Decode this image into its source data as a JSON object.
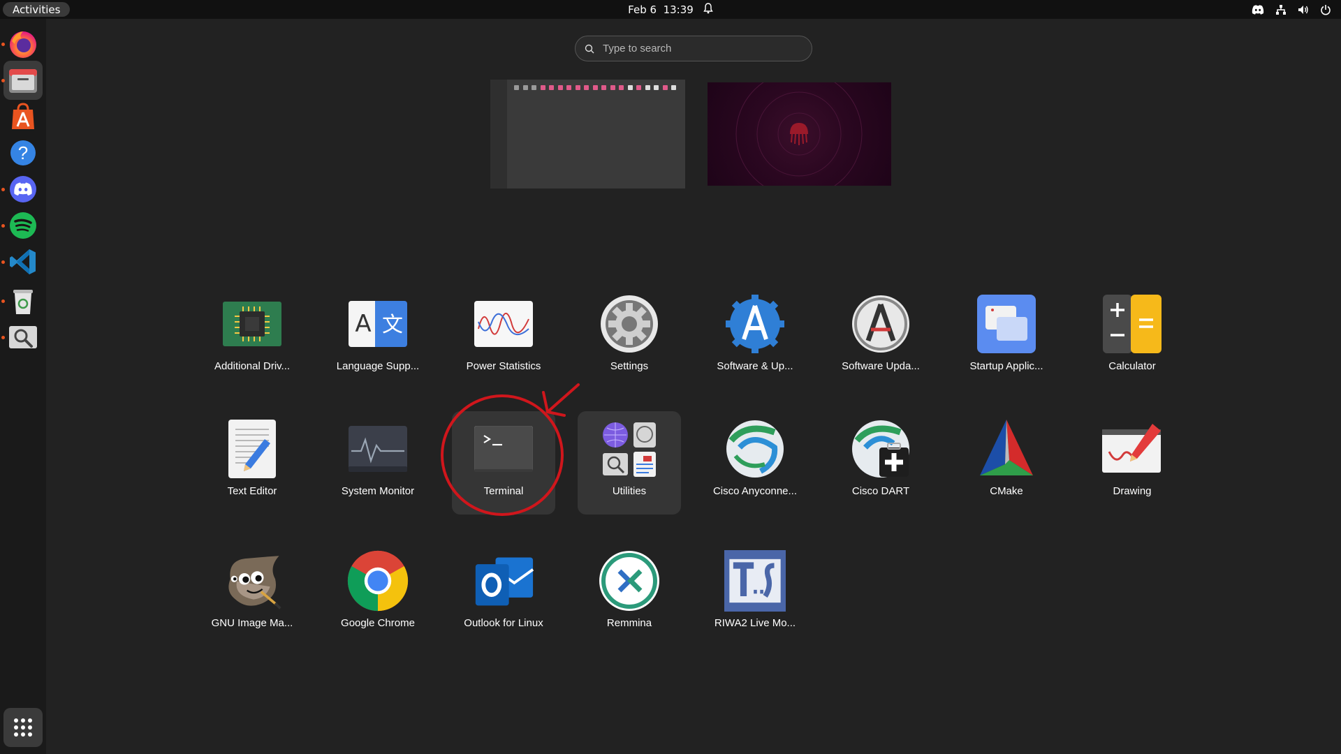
{
  "topbar": {
    "activities_label": "Activities",
    "date": "Feb 6",
    "time": "13:39"
  },
  "search": {
    "placeholder": "Type to search",
    "value": ""
  },
  "dock": {
    "items": [
      {
        "name": "Firefox",
        "icon": "firefox-icon",
        "running": true
      },
      {
        "name": "Files",
        "icon": "files-icon",
        "running": true
      },
      {
        "name": "Ubuntu Software",
        "icon": "software-icon",
        "running": false
      },
      {
        "name": "Help",
        "icon": "help-icon",
        "running": false
      },
      {
        "name": "Discord",
        "icon": "discord-icon",
        "running": true
      },
      {
        "name": "Spotify",
        "icon": "spotify-icon",
        "running": true
      },
      {
        "name": "Visual Studio Code",
        "icon": "vscode-icon",
        "running": true
      },
      {
        "name": "Trash",
        "icon": "trash-icon",
        "running": true
      },
      {
        "name": "Image Viewer",
        "icon": "image-viewer-icon",
        "running": true
      }
    ]
  },
  "apps": {
    "row1": [
      {
        "label": "Additional Driv...",
        "icon": "chip-icon"
      },
      {
        "label": "Language Supp...",
        "icon": "language-icon"
      },
      {
        "label": "Power Statistics",
        "icon": "power-statistics-icon"
      },
      {
        "label": "Settings",
        "icon": "gear-icon"
      },
      {
        "label": "Software & Up...",
        "icon": "software-sources-icon"
      },
      {
        "label": "Software Upda...",
        "icon": "software-updater-icon"
      },
      {
        "label": "Startup Applic...",
        "icon": "startup-icon"
      },
      {
        "label": "Calculator",
        "icon": "calculator-icon"
      }
    ],
    "row2": [
      {
        "label": "Text Editor",
        "icon": "text-editor-icon"
      },
      {
        "label": "System Monitor",
        "icon": "system-monitor-icon"
      },
      {
        "label": "Terminal",
        "icon": "terminal-icon"
      },
      {
        "label": "Utilities",
        "icon": "folder-icon"
      },
      {
        "label": "Cisco Anyconne...",
        "icon": "cisco-icon"
      },
      {
        "label": "Cisco DART",
        "icon": "cisco-dart-icon"
      },
      {
        "label": "CMake",
        "icon": "cmake-icon"
      },
      {
        "label": "Drawing",
        "icon": "drawing-icon"
      }
    ],
    "row3": [
      {
        "label": "GNU Image Ma...",
        "icon": "gimp-icon"
      },
      {
        "label": "Google Chrome",
        "icon": "chrome-icon"
      },
      {
        "label": "Outlook for Linux",
        "icon": "outlook-icon"
      },
      {
        "label": "Remmina",
        "icon": "remmina-icon"
      },
      {
        "label": "RIWA2 Live Mo...",
        "icon": "riwa-icon"
      }
    ]
  },
  "colors": {
    "accent": "#e95420",
    "annotation": "#d0161c",
    "background": "#222222"
  }
}
